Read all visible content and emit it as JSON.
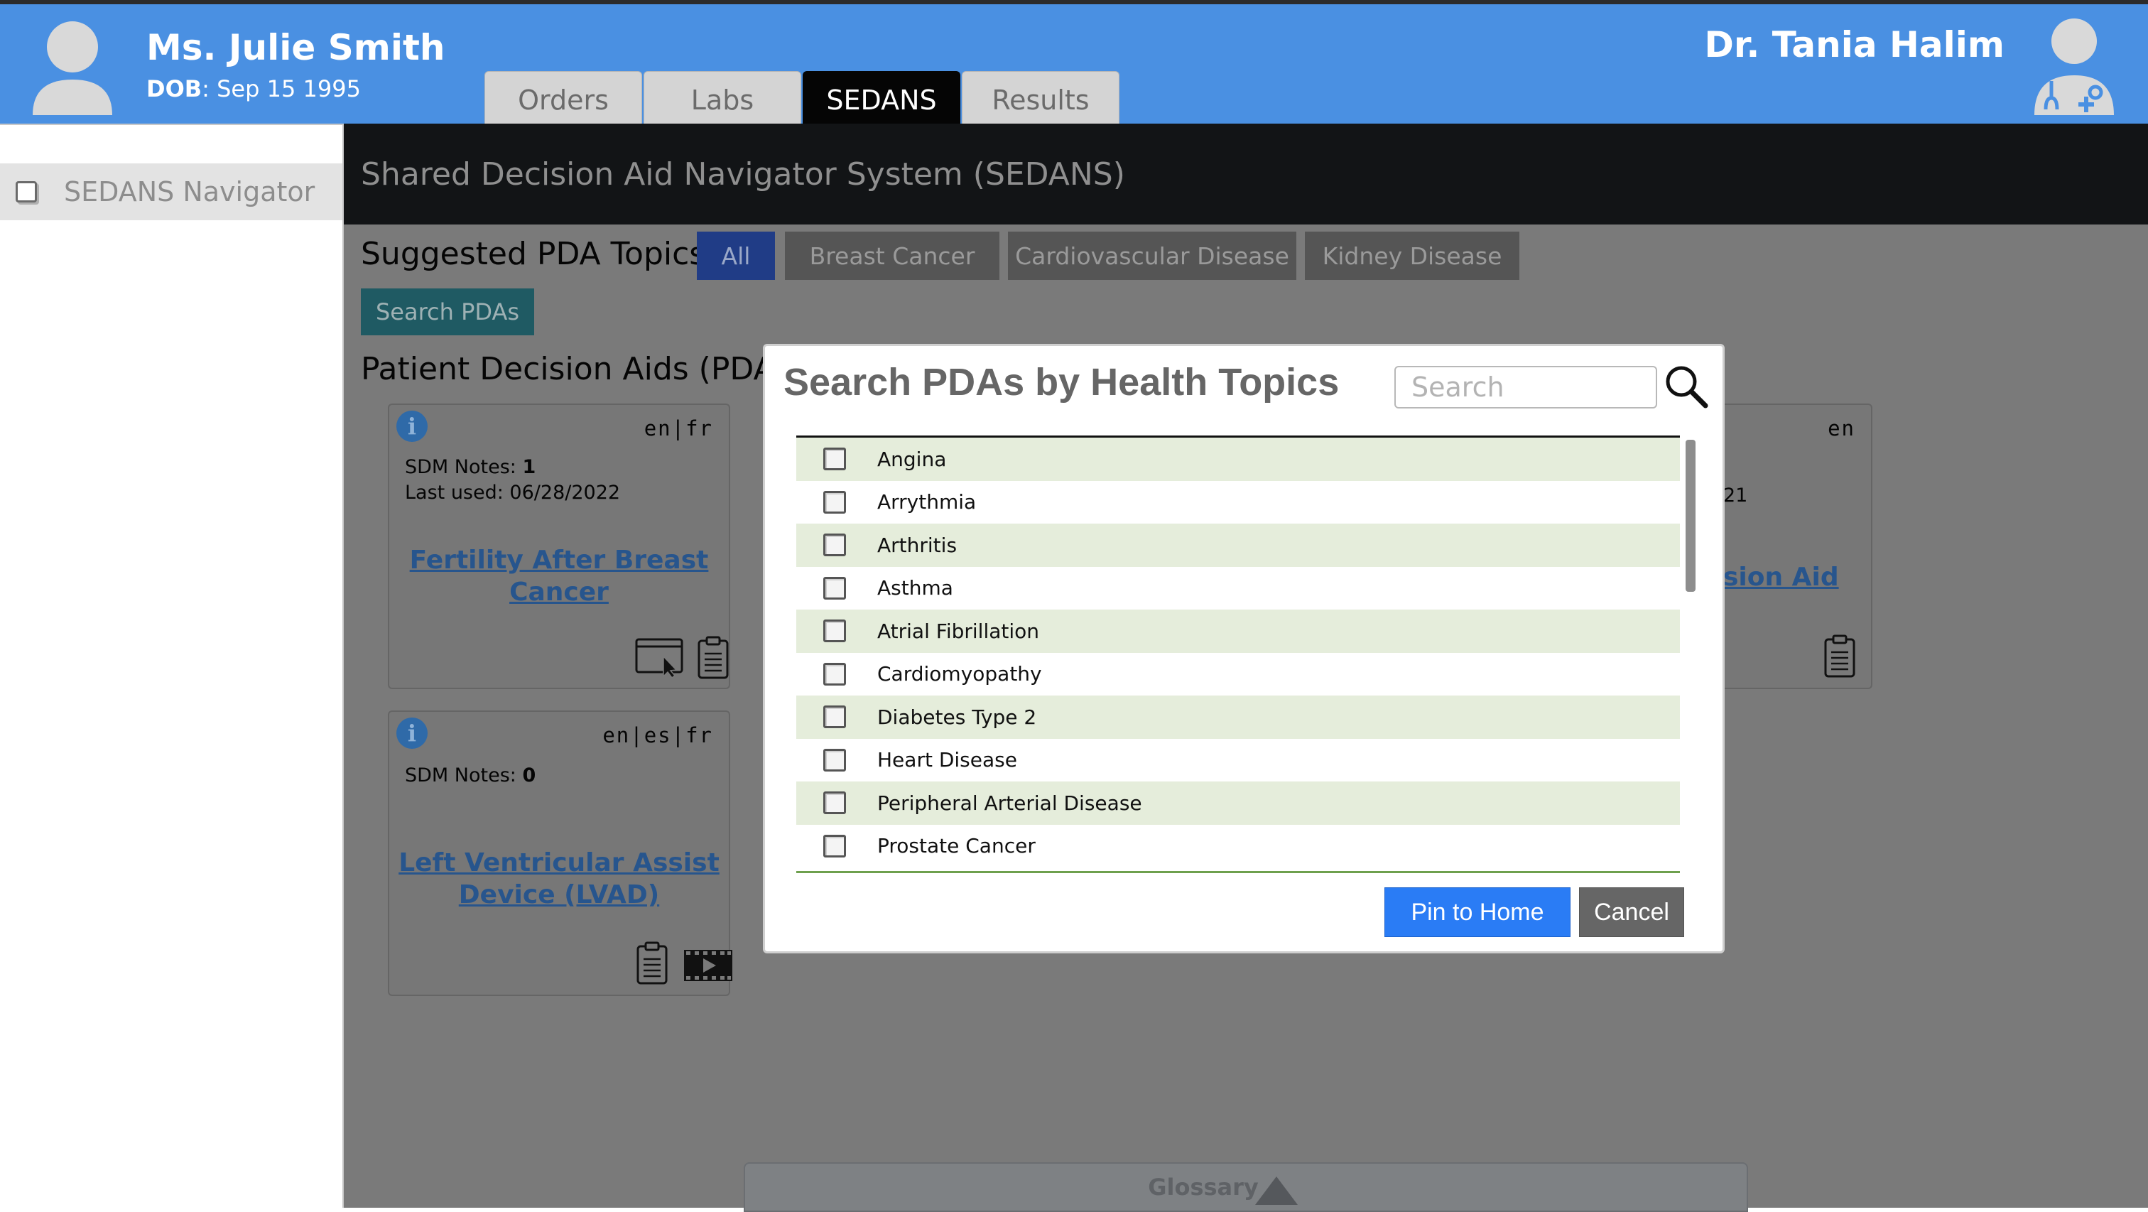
{
  "header": {
    "patient_name": "Ms. Julie Smith",
    "dob_label": "DOB",
    "dob_value": ": Sep 15 1995",
    "doctor_name": "Dr. Tania Halim",
    "tabs": [
      {
        "label": "Orders",
        "active": false
      },
      {
        "label": "Labs",
        "active": false
      },
      {
        "label": "SEDANS",
        "active": true
      },
      {
        "label": "Results",
        "active": false
      }
    ]
  },
  "sidebar": {
    "items": [
      {
        "label": "SEDANS Navigator"
      }
    ]
  },
  "main": {
    "title": "Shared Decision Aid Navigator System (SEDANS)",
    "topics_label": "Suggested PDA Topics:",
    "topic_buttons": [
      "All",
      "Breast Cancer",
      "Cardiovascular Disease",
      "Kidney Disease"
    ],
    "search_pdas_label": "Search PDAs",
    "pda_label": "Patient Decision Aids (PDA):",
    "cards": [
      {
        "langs": "en|fr",
        "notes_label": "SDM Notes: ",
        "notes_value": "1",
        "last_used": "Last used: 06/28/2022",
        "title_line1": "Fertility After Breast",
        "title_line2": "Cancer"
      },
      {
        "langs": "en|es|fr",
        "notes_label": "SDM Notes: ",
        "notes_value": "0",
        "title_line1": "Left Ventricular Assist",
        "title_line2": "Device (LVAD)"
      },
      {
        "langs": "en",
        "year_fragment": "21",
        "title_fragment": "sion Aid"
      }
    ],
    "glossary_label": "Glossary"
  },
  "modal": {
    "title": "Search PDAs by Health Topics",
    "search_placeholder": "Search",
    "search_value": "",
    "topics": [
      "Angina",
      "Arrythmia",
      "Arthritis",
      "Asthma",
      "Atrial Fibrillation",
      "Cardiomyopathy",
      "Diabetes Type 2",
      "Heart Disease",
      "Peripheral Arterial Disease",
      "Prostate Cancer"
    ],
    "pin_label": "Pin to Home",
    "cancel_label": "Cancel"
  },
  "colors": {
    "header_bg": "#4a90e2",
    "active_tab": "#050505",
    "topic_active": "#203c86",
    "search_pdas_btn": "#1f5a63",
    "row_alt": "#e5eddb",
    "pin_button": "#2a7cf5",
    "cancel_button": "#666666",
    "link": "#27558d"
  }
}
